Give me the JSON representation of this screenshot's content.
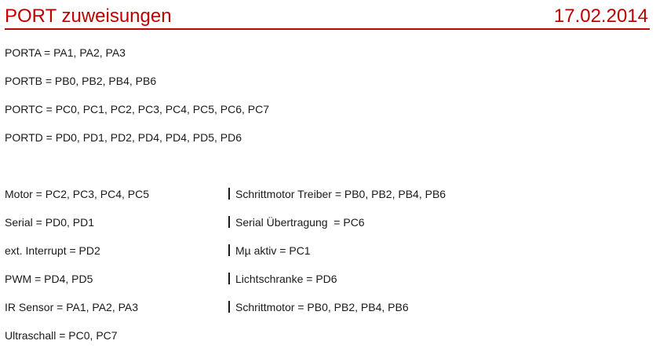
{
  "header": {
    "title": "PORT zuweisungen",
    "date": "17.02.2014"
  },
  "ports": [
    "PORTA = PA1, PA2, PA3",
    "PORTB = PB0, PB2, PB4, PB6",
    "PORTC = PC0, PC1, PC2, PC3, PC4, PC5, PC6, PC7",
    "PORTD = PD0, PD1, PD2, PD4, PD4, PD5, PD6"
  ],
  "assignments_left": [
    "Motor = PC2, PC3, PC4, PC5",
    "Serial = PD0, PD1",
    "ext. Interrupt = PD2",
    "PWM = PD4, PD5",
    "IR Sensor = PA1, PA2, PA3",
    "Ultraschall = PC0, PC7"
  ],
  "assignments_right": [
    "Schrittmotor Treiber = PB0, PB2, PB4, PB6",
    "Serial Übertragung  = PC6",
    "Mµ aktiv = PC1",
    "Lichtschranke = PD6",
    "Schrittmotor = PB0, PB2, PB4, PB6"
  ]
}
